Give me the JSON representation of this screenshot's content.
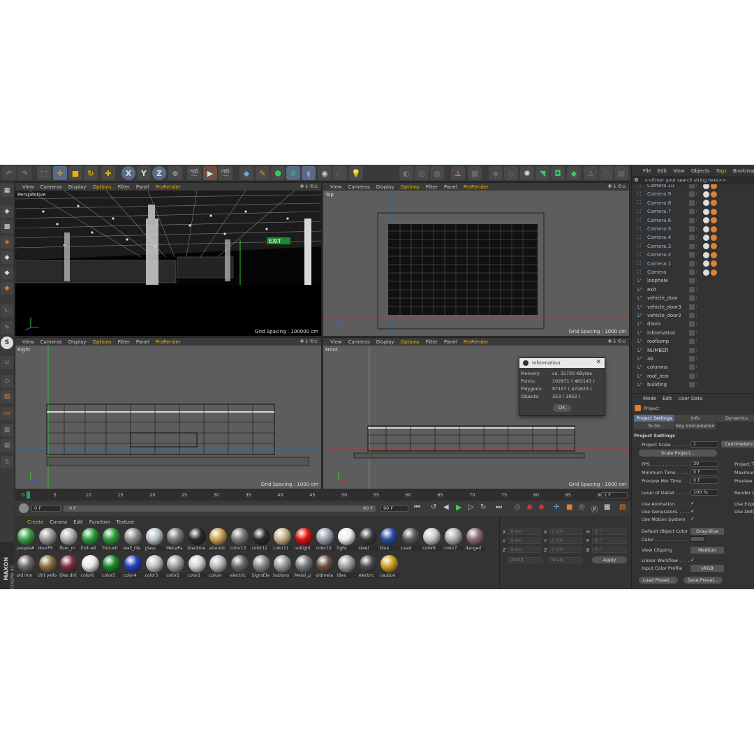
{
  "toolbar": {
    "axis_x": "X",
    "axis_y": "Y",
    "axis_z": "Z"
  },
  "viewport_menu": [
    "View",
    "Cameras",
    "Display",
    "Options",
    "Filter",
    "Panel",
    "ProRender"
  ],
  "viewports": [
    {
      "name": "Perspective",
      "grid": "Grid Spacing : 100000 cm"
    },
    {
      "name": "Top",
      "grid": "Grid Spacing : 1000 cm"
    },
    {
      "name": "Right",
      "grid": "Grid Spacing : 1000 cm"
    },
    {
      "name": "Front",
      "grid": "Grid Spacing : 1000 cm"
    }
  ],
  "scene": {
    "exit_sign": "EXIT"
  },
  "info_dialog": {
    "title": "Information",
    "rows": [
      {
        "label": "Memory:",
        "value": "ca. 32720 KBytes"
      },
      {
        "label": "Points:",
        "value": "102971 ( 483143 )"
      },
      {
        "label": "Polygons:",
        "value": "97157 ( 472623 )"
      },
      {
        "label": "Objects:",
        "value": "353 ( 1952 )"
      }
    ],
    "ok": "OK"
  },
  "timeline": {
    "ticks": [
      "0",
      "5",
      "10",
      "15",
      "20",
      "25",
      "30",
      "35",
      "40",
      "45",
      "50",
      "55",
      "60",
      "65",
      "70",
      "75",
      "80",
      "85",
      "90"
    ],
    "frame_end": "1 F",
    "start": "0 F",
    "slider_start": "0 F",
    "slider_end": "90 F",
    "end": "90 F"
  },
  "material_menu": [
    "Create",
    "Corona",
    "Edit",
    "Function",
    "Texture"
  ],
  "materials_row1": [
    {
      "label": "people#",
      "color": "#3aa04a"
    },
    {
      "label": "doorPS",
      "color": "#9a9a9a"
    },
    {
      "label": "floor_m",
      "color": "#b0b0b0"
    },
    {
      "label": "Exit-wit",
      "color": "#2c9a3a"
    },
    {
      "label": "Exit-wit",
      "color": "#2c9a3a"
    },
    {
      "label": "wall_tile",
      "color": "#8c8c8c"
    },
    {
      "label": "glass",
      "color": "#b8c4cc"
    },
    {
      "label": "MetalPa",
      "color": "#7a7a7a"
    },
    {
      "label": "blackme",
      "color": "#2a2a2a"
    },
    {
      "label": "attentio",
      "color": "#c8a050"
    },
    {
      "label": "color13",
      "color": "#7a7a7a"
    },
    {
      "label": "color12",
      "color": "#2a2a2a"
    },
    {
      "label": "color11",
      "color": "#c8b08a"
    },
    {
      "label": "redlight",
      "color": "#e01010"
    },
    {
      "label": "color10",
      "color": "#9aa4b0"
    },
    {
      "label": "light",
      "color": "#f0f0f0"
    },
    {
      "label": "steel",
      "color": "#3a3a3a"
    },
    {
      "label": "blue",
      "color": "#2a4aa0"
    },
    {
      "label": "Lead",
      "color": "#5a5a5a"
    },
    {
      "label": "color8",
      "color": "#c8c8c8"
    },
    {
      "label": "color7",
      "color": "#b0b0b0"
    },
    {
      "label": "dangerl",
      "color": "#8a6a70"
    }
  ],
  "materials_row2": [
    {
      "label": "old iron",
      "color": "#6a6a6a"
    },
    {
      "label": "dirt yello",
      "color": "#8a7040"
    },
    {
      "label": "tiles dirt",
      "color": "#7a3040"
    },
    {
      "label": "color6",
      "color": "#e8e8e8"
    },
    {
      "label": "color5",
      "color": "#1a8a2a"
    },
    {
      "label": "color4",
      "color": "#2040c0"
    },
    {
      "label": "color3",
      "color": "#c0c0c0"
    },
    {
      "label": "color2",
      "color": "#a0a0a0"
    },
    {
      "label": "color1",
      "color": "#d0d0d0"
    },
    {
      "label": "colum",
      "color": "#b8b8b8"
    },
    {
      "label": "electric",
      "color": "#6a6a6a"
    },
    {
      "label": "SignsEle",
      "color": "#8a8a8a"
    },
    {
      "label": "buttons",
      "color": "#9a9a9a"
    },
    {
      "label": "Metal_p",
      "color": "#7a7a7a"
    },
    {
      "label": "oldmeta",
      "color": "#6a5040"
    },
    {
      "label": "tiles",
      "color": "#a0a0a0"
    },
    {
      "label": "electric",
      "color": "#4a4a4a"
    },
    {
      "label": "caution",
      "color": "#d0a020"
    }
  ],
  "coords": {
    "x": "X",
    "y": "Y",
    "z": "Z",
    "x2": "X",
    "y2": "Y",
    "z2": "Z",
    "h": "H",
    "p": "P",
    "b": "B",
    "zero_cm": "0 cm",
    "zero_deg": "0 °",
    "world": "World",
    "scale": "Scale",
    "apply": "Apply"
  },
  "branding": {
    "maxon": "MAXON",
    "c4d": "CINEMA 4D"
  },
  "object_manager": {
    "menu": [
      "File",
      "Edit",
      "View",
      "Objects",
      "Tags",
      "Bookmarks"
    ],
    "search_placeholder": "<<Enter your search string here>>",
    "objects": [
      "Camera.10",
      "Camera.9",
      "Camera.8",
      "Camera.7",
      "Camera.6",
      "Camera.5",
      "Camera.4",
      "Camera.3",
      "Camera.2",
      "Camera.1",
      "Camera",
      "loophole",
      "exit",
      "vehicle_door",
      "vehicle_door3",
      "vehicle_door2",
      "doors",
      "information",
      "rooflamp",
      "NUMBER",
      "ab",
      "columns",
      "roof_iron",
      "building"
    ]
  },
  "attributes": {
    "menu": [
      "Mode",
      "Edit",
      "User Data"
    ],
    "object": "Project",
    "tabs": [
      "Project Settings",
      "Info",
      "Dynamics",
      "To Do",
      "Key Interpolation"
    ],
    "section": "Project Settings",
    "project_scale_label": "Project Scale . . . . . .",
    "project_scale": "1",
    "unit": "Centimeters",
    "scale_project": "Scale Project...",
    "fps_label": "FPS . . . . . . . . . . . . .",
    "fps": "30",
    "project_t": "Project Ti",
    "min_time_label": "Minimum Time. . . . . . .",
    "min_time": "0 F",
    "max_label": "Maximum",
    "preview_min_label": "Preview Min Time . . .",
    "preview_min": "0 F",
    "preview_m": "Preview M",
    "lod_label": "Level of Detail . . . . .",
    "lod": "100 %",
    "render_lo": "Render Lo",
    "use_anim": "Use Animation. . . . . .",
    "use_expr": "Use Expre",
    "use_gen": "Use Generators. . . . .",
    "use_def": "Use Defo",
    "use_motion": "Use Motion System",
    "def_color_label": "Default Object Color",
    "def_color": "Gray-Blue",
    "color_label": "Color . . . . . . . . . . .",
    "view_clip_label": "View Clipping",
    "view_clip": "Medium",
    "linear_label": "Linear Workflow . . . .",
    "input_profile_label": "Input Color Profile",
    "input_profile": "sRGB",
    "check": "✓",
    "load_preset": "Load Preset...",
    "save_preset": "Save Preset..."
  }
}
